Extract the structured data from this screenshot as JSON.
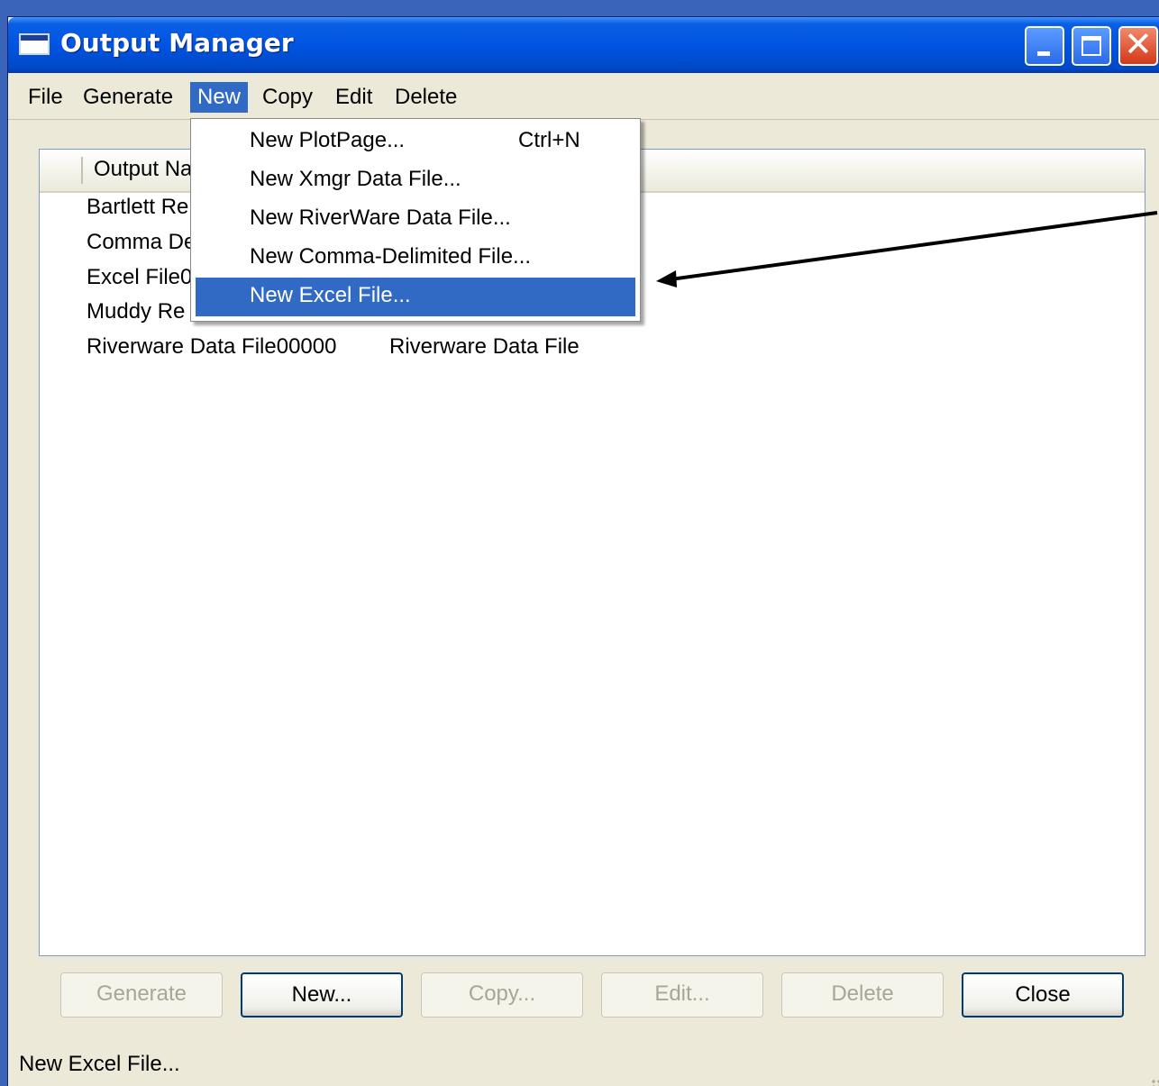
{
  "window": {
    "title": "Output Manager",
    "controls": {
      "minimize": "minimize-icon",
      "maximize": "maximize-icon",
      "close": "close-icon"
    }
  },
  "menubar": {
    "items": [
      "File",
      "Generate",
      "New",
      "Copy",
      "Edit",
      "Delete"
    ],
    "active": "New"
  },
  "new_menu": {
    "items": [
      {
        "label": "New PlotPage...",
        "shortcut": "Ctrl+N"
      },
      {
        "label": "New Xmgr Data File...",
        "shortcut": ""
      },
      {
        "label": "New RiverWare Data File...",
        "shortcut": ""
      },
      {
        "label": "New Comma-Delimited File...",
        "shortcut": ""
      },
      {
        "label": "New Excel File...",
        "shortcut": ""
      }
    ],
    "highlighted": "New Excel File..."
  },
  "list": {
    "columns": [
      "Output Na"
    ],
    "rows": [
      {
        "name": "Bartlett Re",
        "type": ""
      },
      {
        "name": "Comma De",
        "type": ""
      },
      {
        "name": "Excel File0",
        "type": ""
      },
      {
        "name": "Muddy Re",
        "type": ""
      },
      {
        "name": "Riverware Data File00000",
        "type": "Riverware Data File"
      }
    ]
  },
  "buttons": {
    "generate": "Generate",
    "new": "New...",
    "copy": "Copy...",
    "edit": "Edit...",
    "delete": "Delete",
    "close": "Close"
  },
  "statusbar": {
    "text": "New Excel File..."
  },
  "colors": {
    "titlebar": "#0054e3",
    "menu_highlight": "#316ac5",
    "window_bg": "#ece9d8",
    "desktop": "#3a64b8"
  }
}
